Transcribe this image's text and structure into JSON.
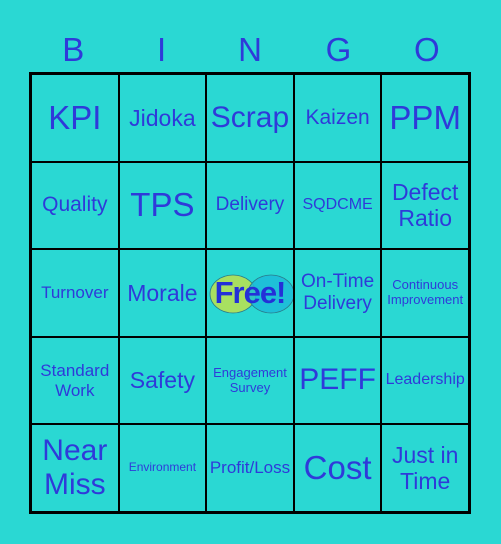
{
  "header": [
    "B",
    "I",
    "N",
    "G",
    "O"
  ],
  "cells": [
    [
      "KPI",
      "Jidoka",
      "Scrap",
      "Kaizen",
      "PPM"
    ],
    [
      "Quality",
      "TPS",
      "Delivery",
      "SQDCME",
      "Defect Ratio"
    ],
    [
      "Turnover",
      "Morale",
      "Free!",
      "On-Time Delivery",
      "Continuous Improvement"
    ],
    [
      "Standard Work",
      "Safety",
      "Engagement Survey",
      "PEFF",
      "Leadership"
    ],
    [
      "Near Miss",
      "Environment",
      "Profit/Loss",
      "Cost",
      "Just in Time"
    ]
  ],
  "colors": {
    "background": "#2ad8d3",
    "text": "#2f3ad9",
    "free_left": "#a8e060",
    "free_right": "#1cbcd8"
  }
}
